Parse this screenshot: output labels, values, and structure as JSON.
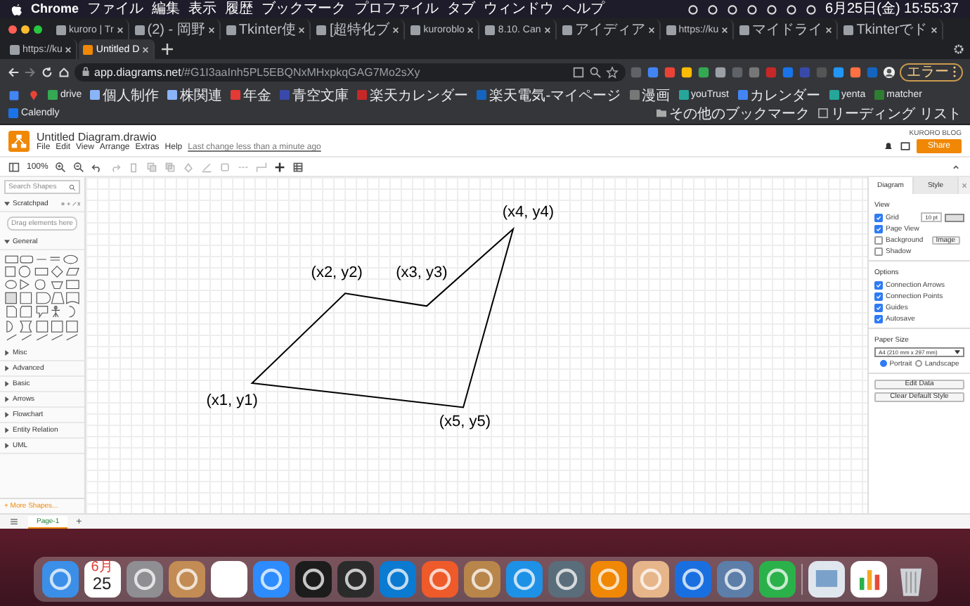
{
  "menubar": {
    "app": "Chrome",
    "items": [
      "ファイル",
      "編集",
      "表示",
      "履歴",
      "ブックマーク",
      "プロファイル",
      "タブ",
      "ウィンドウ",
      "ヘルプ"
    ],
    "clock": "6月25日(金) 15:55:37"
  },
  "tabs": [
    {
      "title": "kuroro | Tr",
      "selected": false
    },
    {
      "title": "(2) - 岡野",
      "selected": false
    },
    {
      "title": "Tkinter使",
      "selected": false
    },
    {
      "title": "[超特化ブ",
      "selected": false
    },
    {
      "title": "kuroroblo",
      "selected": false
    },
    {
      "title": "8.10. Can",
      "selected": false
    },
    {
      "title": "アイディア",
      "selected": false
    },
    {
      "title": "https://ku",
      "selected": false
    },
    {
      "title": "マイドライ",
      "selected": false
    },
    {
      "title": "Tkinterでド",
      "selected": false
    },
    {
      "title": "https://ku",
      "selected": false
    },
    {
      "title": "Untitled D",
      "selected": true
    }
  ],
  "address": {
    "host": "app.diagrams.net",
    "path": "/#G1I3aaInh5PL5EBQNxMHxpkqGAG7Mo2sXy"
  },
  "profile_button": "エラー",
  "bookmarks": [
    "drive",
    "個人制作",
    "株関連",
    "年金",
    "青空文庫",
    "楽天カレンダー",
    "楽天電気-マイページ",
    "漫画",
    "youTrust",
    "カレンダー",
    "yenta",
    "matcher",
    "Calendly"
  ],
  "other_bookmarks": "その他のブックマーク",
  "reading_list": "リーディング リスト",
  "drawio": {
    "title": "Untitled Diagram.drawio",
    "menus": [
      "File",
      "Edit",
      "View",
      "Arrange",
      "Extras",
      "Help"
    ],
    "last_change": "Last change less than a minute ago",
    "user": "KURORO BLOG",
    "share": "Share",
    "zoom": "100%",
    "search_placeholder": "Search Shapes",
    "scratchpad": "Scratchpad",
    "scratch_hint": "Drag elements here",
    "general": "General",
    "categories": [
      "Misc",
      "Advanced",
      "Basic",
      "Arrows",
      "Flowchart",
      "Entity Relation",
      "UML"
    ],
    "more_shapes": "+ More Shapes...",
    "panel_tabs": [
      {
        "label": "Diagram",
        "selected": true
      },
      {
        "label": "Style",
        "selected": false
      }
    ],
    "view_heading": "View",
    "view_options": [
      {
        "label": "Grid",
        "checked": true
      },
      {
        "label": "Page View",
        "checked": true
      },
      {
        "label": "Background",
        "checked": false
      },
      {
        "label": "Shadow",
        "checked": false
      }
    ],
    "grid_size": "10 pt",
    "image_button": "Image",
    "options_heading": "Options",
    "options": [
      {
        "label": "Connection Arrows",
        "checked": true
      },
      {
        "label": "Connection Points",
        "checked": true
      },
      {
        "label": "Guides",
        "checked": true
      },
      {
        "label": "Autosave",
        "checked": true
      }
    ],
    "paper_heading": "Paper Size",
    "paper_size": "A4 (210 mm x 297 mm)",
    "orientation": [
      {
        "label": "Portrait",
        "selected": true
      },
      {
        "label": "Landscape",
        "selected": false
      }
    ],
    "buttons": [
      "Edit Data",
      "Clear Default Style"
    ],
    "pages": [
      {
        "label": "Page-1",
        "selected": true
      }
    ],
    "add_page": "+"
  },
  "canvas": {
    "points": [
      "(x1, y1)",
      "(x2, y2)",
      "(x3, y3)",
      "(x4, y4)",
      "(x5, y5)"
    ]
  },
  "dock": {
    "calendar_month": "6月",
    "calendar_day": "25"
  }
}
